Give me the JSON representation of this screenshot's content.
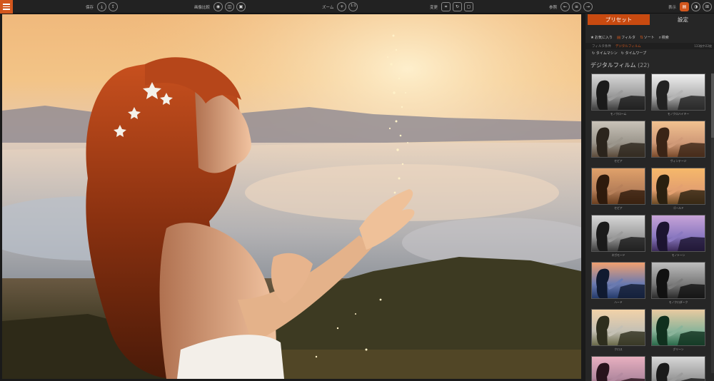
{
  "toolbar": {
    "menu_icon": "hamburger-icon",
    "save": {
      "label": "保存",
      "buttons": [
        "save-icon",
        "share-icon"
      ]
    },
    "compare": {
      "label": "画像比較",
      "buttons": [
        "eye-icon",
        "split-view-icon",
        "side-by-side-icon"
      ]
    },
    "zoom": {
      "label": "ズーム",
      "fit_label": "+",
      "ratio_label": "1:1"
    },
    "transform": {
      "label": "変更",
      "buttons": [
        "crop-icon",
        "rotate-icon",
        "frame-icon"
      ]
    },
    "history": {
      "label": "参照",
      "buttons": [
        "undo-icon",
        "history-icon",
        "redo-icon"
      ]
    },
    "view": {
      "label": "表示",
      "buttons": [
        "panel-icon",
        "before-after-icon",
        "layout-icon"
      ]
    }
  },
  "panel": {
    "tabs": [
      {
        "label": "プリセット",
        "active": true
      },
      {
        "label": "設定",
        "active": false
      }
    ],
    "filters": [
      {
        "icon": "star-icon",
        "label": "お気に入り"
      },
      {
        "icon": "filter-icon",
        "label": "フィルタ"
      },
      {
        "icon": "sort-icon",
        "label": "ソート"
      },
      {
        "icon": "search-icon",
        "label": "検索"
      }
    ],
    "breadcrumb": {
      "root": "フィルタ条件",
      "current": "デジタルフィルム",
      "count": "133枚中22枚"
    },
    "subfilters": [
      {
        "icon": "clock-icon",
        "label": "タイムマシン"
      },
      {
        "icon": "warp-icon",
        "label": "タイムワープ"
      }
    ],
    "group_title": "デジタルフィルム",
    "group_count": "(22)",
    "thumbnails": [
      {
        "caption": "モノクローム",
        "style": "bw"
      },
      {
        "caption": "モノクロハイキー",
        "style": "bw2"
      },
      {
        "caption": "セピア",
        "style": "muted"
      },
      {
        "caption": "ヴィンテージ",
        "style": "warm"
      },
      {
        "caption": "セピア",
        "style": "sepia"
      },
      {
        "caption": "ゴールド",
        "style": "gold"
      },
      {
        "caption": "ネガモード",
        "style": "bw"
      },
      {
        "caption": "モノトーン",
        "style": "purple"
      },
      {
        "caption": "ハード",
        "style": "cross"
      },
      {
        "caption": "モノクロダーク",
        "style": "bw3"
      },
      {
        "caption": "クロス",
        "style": "pale"
      },
      {
        "caption": "グリーン",
        "style": "green"
      },
      {
        "caption": "",
        "style": "pink"
      },
      {
        "caption": "",
        "style": "bw"
      }
    ]
  },
  "colors": {
    "accent": "#c84a10",
    "panel_bg": "#262626",
    "toolbar_bg": "#222222"
  }
}
